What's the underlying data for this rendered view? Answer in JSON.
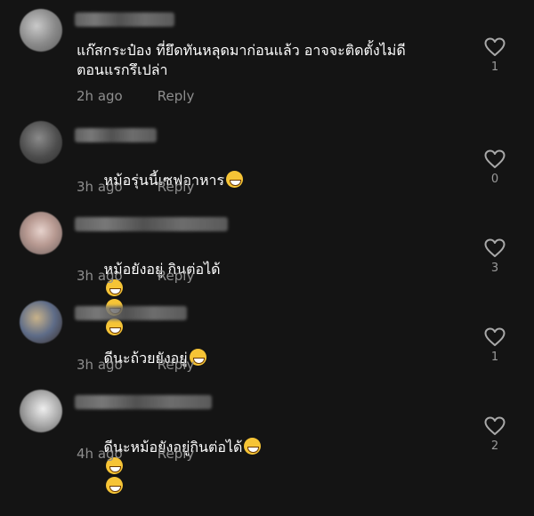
{
  "comments": [
    {
      "text": "แก๊สกระป๋อง ที่ยึดทันหลุดมาก่อนแล้ว อาจจะติดตั้งไม่ดี\nตอนแรกรึเปล่า",
      "emojis": [],
      "time": "2h ago",
      "reply": "Reply",
      "likes": "1"
    },
    {
      "text": "หม้อรุ่นนี้เซฟอาหาร",
      "emojis": [
        "grin-emoji"
      ],
      "time": "3h ago",
      "reply": "Reply",
      "likes": "0"
    },
    {
      "text": "หม้อยังอยู่ กินต่อได้",
      "emojis": [
        "joy-emoji",
        "joy-emoji",
        "joy-emoji"
      ],
      "time": "3h ago",
      "reply": "Reply",
      "likes": "3"
    },
    {
      "text": "ดีนะถ้วยยังอยู่",
      "emojis": [
        "joy-emoji"
      ],
      "time": "3h ago",
      "reply": "Reply",
      "likes": "1"
    },
    {
      "text": "ดีนะหม้อยังอยู่กินต่อได้",
      "emojis": [
        "grin-emoji",
        "grin-emoji",
        "grin-emoji"
      ],
      "time": "4h ago",
      "reply": "Reply",
      "likes": "2"
    }
  ],
  "icons": {
    "like": "heart-outline-icon"
  },
  "colors": {
    "background": "#141414",
    "meta_text": "#8e8e8e",
    "emoji": "#f6c436"
  }
}
